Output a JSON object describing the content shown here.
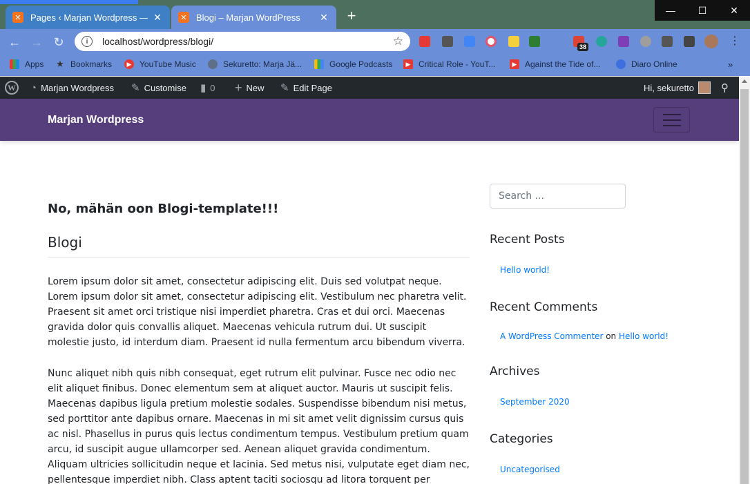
{
  "browser": {
    "tabs": [
      {
        "title": "Pages ‹ Marjan Wordpress — Wo",
        "active": false
      },
      {
        "title": "Blogi – Marjan WordPress",
        "active": true
      }
    ],
    "address": "localhost/wordpress/blogi/",
    "extension_badge": "38",
    "bookmarks": [
      {
        "label": "Apps",
        "icon": "apps-grid-icon"
      },
      {
        "label": "Bookmarks",
        "icon": "star-icon"
      },
      {
        "label": "YouTube Music",
        "icon": "youtube-music-icon"
      },
      {
        "label": "Sekuretto: Marja Jä...",
        "icon": "globe-icon"
      },
      {
        "label": "Google Podcasts",
        "icon": "google-podcasts-icon"
      },
      {
        "label": "Critical Role - YouT...",
        "icon": "youtube-icon"
      },
      {
        "label": "Against the Tide of...",
        "icon": "youtube-icon"
      },
      {
        "label": "Diaro Online",
        "icon": "diaro-icon"
      }
    ],
    "bookmarks_more": "»"
  },
  "wp_admin_bar": {
    "site_name": "Marjan Wordpress",
    "customise": "Customise",
    "comments_count": "0",
    "new": "New",
    "edit_page": "Edit Page",
    "greeting": "Hi, sekuretto"
  },
  "site": {
    "title": "Marjan Wordpress"
  },
  "main": {
    "template_note": "No, mähän oon Blogi-template!!!",
    "page_title": "Blogi",
    "paragraphs": [
      "Lorem ipsum dolor sit amet, consectetur adipiscing elit. Duis sed volutpat neque. Lorem ipsum dolor sit amet, consectetur adipiscing elit. Vestibulum nec pharetra velit. Praesent sit amet orci tristique nisi imperdiet pharetra. Cras et dui orci. Maecenas gravida dolor quis convallis aliquet. Maecenas vehicula rutrum dui. Ut suscipit molestie justo, id interdum diam. Praesent id nulla fermentum arcu bibendum viverra.",
      "Nunc aliquet nibh quis nibh consequat, eget rutrum elit pulvinar. Fusce nec odio nec elit aliquet finibus. Donec elementum sem at aliquet auctor. Mauris ut suscipit felis. Maecenas dapibus ligula pretium molestie sodales. Suspendisse bibendum nisi metus, sed porttitor ante dapibus ornare. Maecenas in mi sit amet velit dignissim cursus quis ac nisl. Phasellus in purus quis lectus condimentum tempus. Vestibulum pretium quam arcu, id suscipit augue ullamcorper sed. Aenean aliquet gravida condimentum. Aliquam ultricies sollicitudin neque et lacinia. Sed metus nisi, vulputate eget diam nec, pellentesque imperdiet nibh. Class aptent taciti sociosqu ad litora torquent per conubia nostra, per inceptos himenaeos."
    ]
  },
  "sidebar": {
    "search_placeholder": "Search ...",
    "recent_posts_title": "Recent Posts",
    "recent_posts": [
      "Hello world!"
    ],
    "recent_comments_title": "Recent Comments",
    "recent_comment": {
      "author": "A WordPress Commenter",
      "connector": "on",
      "post": "Hello world!"
    },
    "archives_title": "Archives",
    "archives": [
      "September 2020"
    ],
    "categories_title": "Categories",
    "categories": [
      "Uncategorised"
    ]
  },
  "colors": {
    "header_purple": "#563d7c",
    "admin_bar": "#23282d",
    "link_blue": "#007bff",
    "chrome_frame": "#6a8fd8"
  }
}
